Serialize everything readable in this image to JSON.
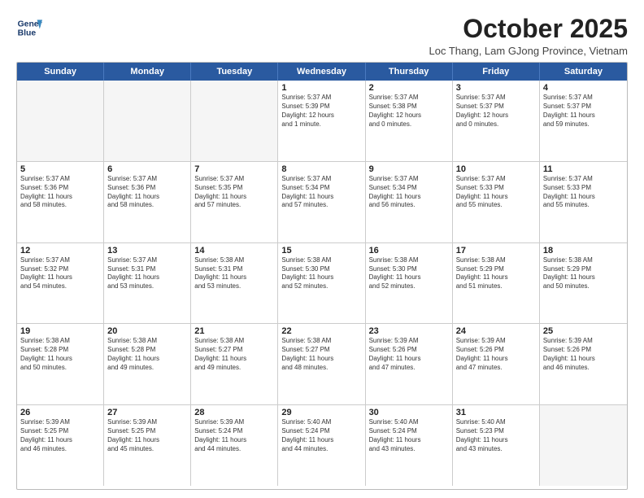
{
  "logo": {
    "line1": "General",
    "line2": "Blue"
  },
  "title": "October 2025",
  "subtitle": "Loc Thang, Lam GJong Province, Vietnam",
  "weekdays": [
    "Sunday",
    "Monday",
    "Tuesday",
    "Wednesday",
    "Thursday",
    "Friday",
    "Saturday"
  ],
  "weeks": [
    [
      {
        "day": "",
        "text": "",
        "empty": true
      },
      {
        "day": "",
        "text": "",
        "empty": true
      },
      {
        "day": "",
        "text": "",
        "empty": true
      },
      {
        "day": "1",
        "text": "Sunrise: 5:37 AM\nSunset: 5:39 PM\nDaylight: 12 hours\nand 1 minute.",
        "empty": false
      },
      {
        "day": "2",
        "text": "Sunrise: 5:37 AM\nSunset: 5:38 PM\nDaylight: 12 hours\nand 0 minutes.",
        "empty": false
      },
      {
        "day": "3",
        "text": "Sunrise: 5:37 AM\nSunset: 5:37 PM\nDaylight: 12 hours\nand 0 minutes.",
        "empty": false
      },
      {
        "day": "4",
        "text": "Sunrise: 5:37 AM\nSunset: 5:37 PM\nDaylight: 11 hours\nand 59 minutes.",
        "empty": false
      }
    ],
    [
      {
        "day": "5",
        "text": "Sunrise: 5:37 AM\nSunset: 5:36 PM\nDaylight: 11 hours\nand 58 minutes.",
        "empty": false
      },
      {
        "day": "6",
        "text": "Sunrise: 5:37 AM\nSunset: 5:36 PM\nDaylight: 11 hours\nand 58 minutes.",
        "empty": false
      },
      {
        "day": "7",
        "text": "Sunrise: 5:37 AM\nSunset: 5:35 PM\nDaylight: 11 hours\nand 57 minutes.",
        "empty": false
      },
      {
        "day": "8",
        "text": "Sunrise: 5:37 AM\nSunset: 5:34 PM\nDaylight: 11 hours\nand 57 minutes.",
        "empty": false
      },
      {
        "day": "9",
        "text": "Sunrise: 5:37 AM\nSunset: 5:34 PM\nDaylight: 11 hours\nand 56 minutes.",
        "empty": false
      },
      {
        "day": "10",
        "text": "Sunrise: 5:37 AM\nSunset: 5:33 PM\nDaylight: 11 hours\nand 55 minutes.",
        "empty": false
      },
      {
        "day": "11",
        "text": "Sunrise: 5:37 AM\nSunset: 5:33 PM\nDaylight: 11 hours\nand 55 minutes.",
        "empty": false
      }
    ],
    [
      {
        "day": "12",
        "text": "Sunrise: 5:37 AM\nSunset: 5:32 PM\nDaylight: 11 hours\nand 54 minutes.",
        "empty": false
      },
      {
        "day": "13",
        "text": "Sunrise: 5:37 AM\nSunset: 5:31 PM\nDaylight: 11 hours\nand 53 minutes.",
        "empty": false
      },
      {
        "day": "14",
        "text": "Sunrise: 5:38 AM\nSunset: 5:31 PM\nDaylight: 11 hours\nand 53 minutes.",
        "empty": false
      },
      {
        "day": "15",
        "text": "Sunrise: 5:38 AM\nSunset: 5:30 PM\nDaylight: 11 hours\nand 52 minutes.",
        "empty": false
      },
      {
        "day": "16",
        "text": "Sunrise: 5:38 AM\nSunset: 5:30 PM\nDaylight: 11 hours\nand 52 minutes.",
        "empty": false
      },
      {
        "day": "17",
        "text": "Sunrise: 5:38 AM\nSunset: 5:29 PM\nDaylight: 11 hours\nand 51 minutes.",
        "empty": false
      },
      {
        "day": "18",
        "text": "Sunrise: 5:38 AM\nSunset: 5:29 PM\nDaylight: 11 hours\nand 50 minutes.",
        "empty": false
      }
    ],
    [
      {
        "day": "19",
        "text": "Sunrise: 5:38 AM\nSunset: 5:28 PM\nDaylight: 11 hours\nand 50 minutes.",
        "empty": false
      },
      {
        "day": "20",
        "text": "Sunrise: 5:38 AM\nSunset: 5:28 PM\nDaylight: 11 hours\nand 49 minutes.",
        "empty": false
      },
      {
        "day": "21",
        "text": "Sunrise: 5:38 AM\nSunset: 5:27 PM\nDaylight: 11 hours\nand 49 minutes.",
        "empty": false
      },
      {
        "day": "22",
        "text": "Sunrise: 5:38 AM\nSunset: 5:27 PM\nDaylight: 11 hours\nand 48 minutes.",
        "empty": false
      },
      {
        "day": "23",
        "text": "Sunrise: 5:39 AM\nSunset: 5:26 PM\nDaylight: 11 hours\nand 47 minutes.",
        "empty": false
      },
      {
        "day": "24",
        "text": "Sunrise: 5:39 AM\nSunset: 5:26 PM\nDaylight: 11 hours\nand 47 minutes.",
        "empty": false
      },
      {
        "day": "25",
        "text": "Sunrise: 5:39 AM\nSunset: 5:26 PM\nDaylight: 11 hours\nand 46 minutes.",
        "empty": false
      }
    ],
    [
      {
        "day": "26",
        "text": "Sunrise: 5:39 AM\nSunset: 5:25 PM\nDaylight: 11 hours\nand 46 minutes.",
        "empty": false
      },
      {
        "day": "27",
        "text": "Sunrise: 5:39 AM\nSunset: 5:25 PM\nDaylight: 11 hours\nand 45 minutes.",
        "empty": false
      },
      {
        "day": "28",
        "text": "Sunrise: 5:39 AM\nSunset: 5:24 PM\nDaylight: 11 hours\nand 44 minutes.",
        "empty": false
      },
      {
        "day": "29",
        "text": "Sunrise: 5:40 AM\nSunset: 5:24 PM\nDaylight: 11 hours\nand 44 minutes.",
        "empty": false
      },
      {
        "day": "30",
        "text": "Sunrise: 5:40 AM\nSunset: 5:24 PM\nDaylight: 11 hours\nand 43 minutes.",
        "empty": false
      },
      {
        "day": "31",
        "text": "Sunrise: 5:40 AM\nSunset: 5:23 PM\nDaylight: 11 hours\nand 43 minutes.",
        "empty": false
      },
      {
        "day": "",
        "text": "",
        "empty": true
      }
    ]
  ]
}
